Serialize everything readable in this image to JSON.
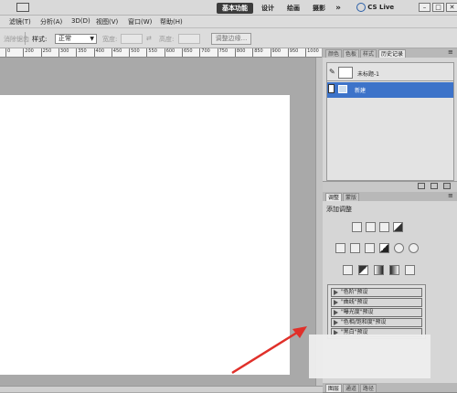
{
  "appbar": {
    "workspaces": [
      "基本功能",
      "设计",
      "绘画",
      "摄影"
    ],
    "more": "»",
    "cs_live": "CS Live",
    "window_buttons": [
      "–",
      "□",
      "✕"
    ]
  },
  "menubar": {
    "items": [
      "滤镜(T)",
      "分析(A)",
      "3D(D)",
      "视图(V)",
      "窗口(W)",
      "帮助(H)"
    ]
  },
  "optionsbar": {
    "erase_label": "消除锯齿",
    "style_label": "样式:",
    "style_value": "正常",
    "width_label": "宽度:",
    "height_label": "高度:",
    "refine_edge": "调整边缘..."
  },
  "ruler": {
    "labels": [
      "0",
      "200",
      "250",
      "300",
      "350",
      "400",
      "450",
      "500",
      "550",
      "600",
      "650",
      "700",
      "750",
      "800",
      "850",
      "900",
      "950",
      "1000",
      "10"
    ]
  },
  "history_panel": {
    "tabs": [
      "颜色",
      "色板",
      "样式",
      "历史记录"
    ],
    "snapshot": "未标题-1",
    "steps": [
      "新建"
    ]
  },
  "adjust_panel": {
    "tabs": [
      "调整",
      "蒙版"
    ],
    "title": "添加调整",
    "presets": [
      "\"色阶\"预设",
      "\"曲线\"预设",
      "\"曝光度\"预设",
      "\"色相/饱和度\"预设",
      "\"黑白\"预设"
    ]
  },
  "bottom_tabs": [
    "图层",
    "通道",
    "路径"
  ],
  "colors": {
    "accent_selected": "#3d73c9",
    "arrow": "#e0302a"
  }
}
